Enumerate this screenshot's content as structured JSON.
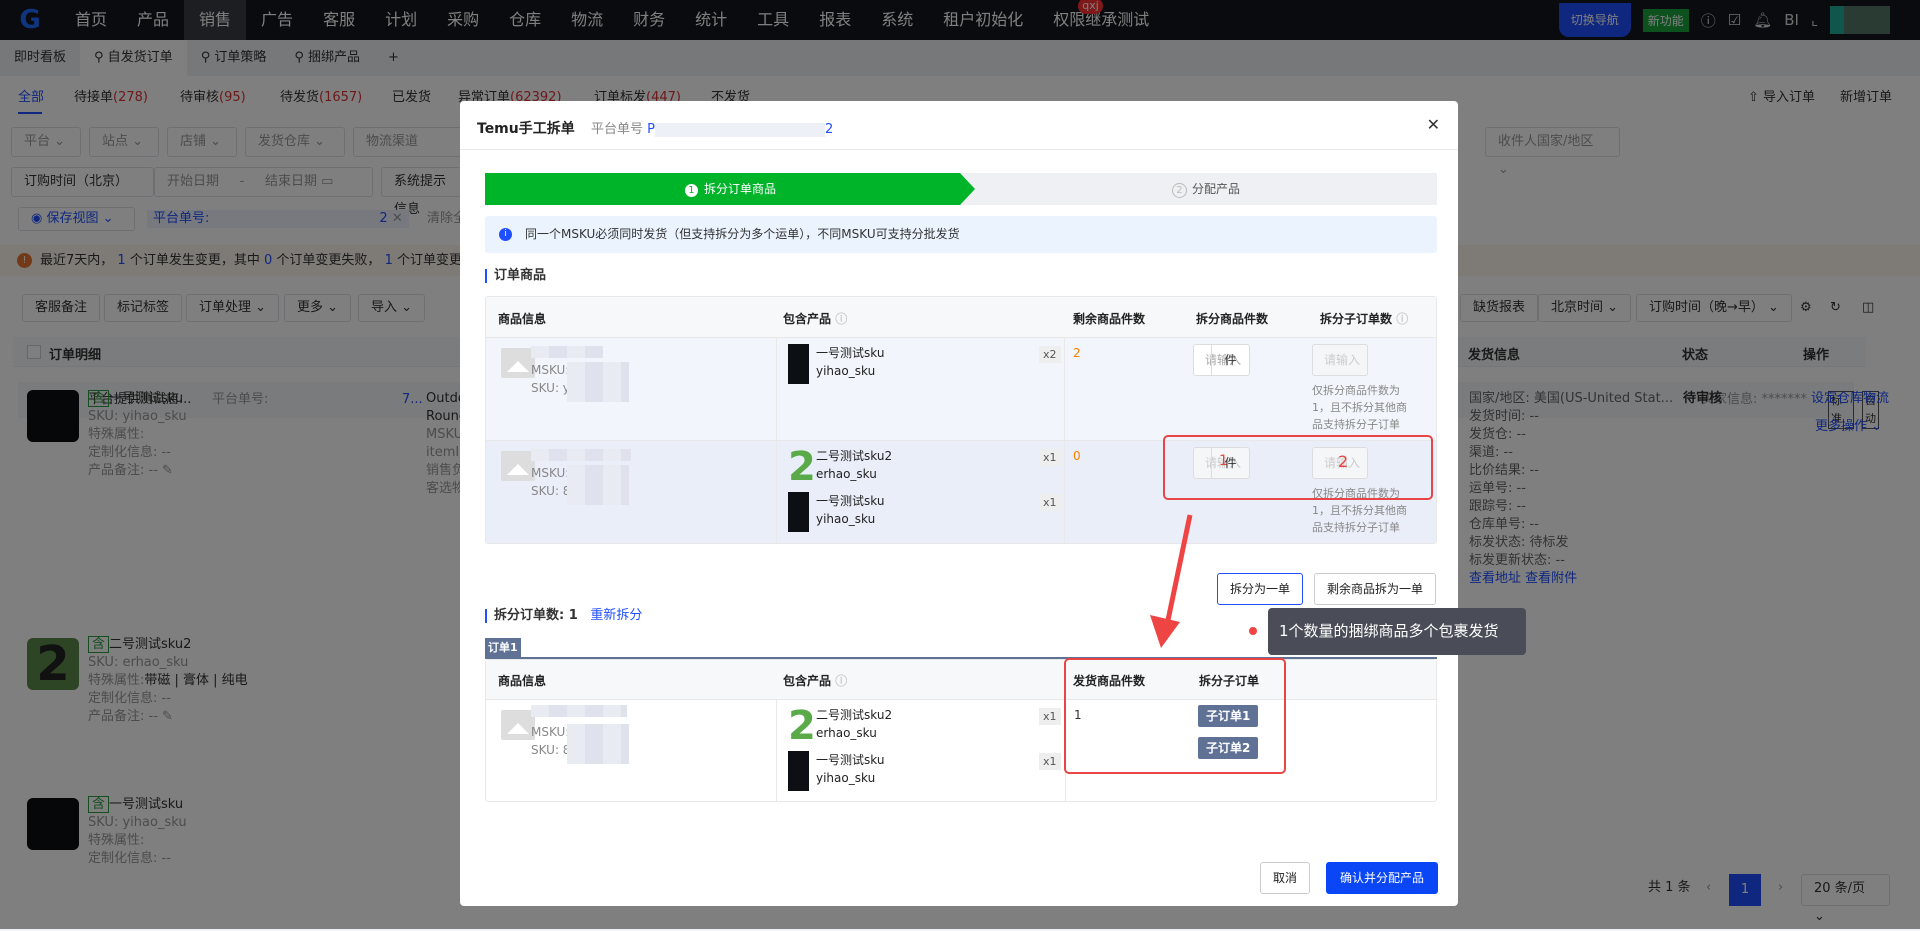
{
  "nav": {
    "logo": "G",
    "items": [
      "首页",
      "产品",
      "销售",
      "广告",
      "客服",
      "计划",
      "采购",
      "仓库",
      "物流",
      "财务",
      "统计",
      "工具",
      "报表",
      "系统",
      "租户初始化",
      "权限继承测试"
    ],
    "badge": "qxj",
    "switch_nav": "切换导航",
    "new_feature": "新功能",
    "bi": "BI"
  },
  "tabs": [
    "即时看板",
    "自发货订单",
    "订单策略",
    "捆绑产品",
    "+"
  ],
  "status_tabs": [
    {
      "label": "全部",
      "count": ""
    },
    {
      "label": "待接单",
      "count": "(278)"
    },
    {
      "label": "待审核",
      "count": "(95)"
    },
    {
      "label": "待发货",
      "count": "(1657)"
    },
    {
      "label": "已发货",
      "count": ""
    },
    {
      "label": "异常订单",
      "count": "(62392)"
    },
    {
      "label": "订单标发",
      "count": "(447)"
    },
    {
      "label": "不发货",
      "count": ""
    }
  ],
  "top_actions": {
    "import": "导入订单",
    "add": "新增订单"
  },
  "filters": {
    "platform": "平台",
    "site": "站点",
    "store": "店铺",
    "warehouse": "发货仓库",
    "channel": "物流渠道",
    "country": "收件人国家/地区",
    "time_type": "订购时间（北京）",
    "start": "开始日期",
    "end": "结束日期",
    "sys": "系统提示信息",
    "save_view": "保存视图",
    "chip_label": "平台单号:",
    "chip_tail": "2",
    "clear": "清除全"
  },
  "notice": {
    "a": "最近7天内，",
    "n1": "1",
    "b": "个订单发生变更，其中",
    "n2": "0",
    "c": "个订单变更失败，",
    "n3": "1",
    "d": "个订单变更成功"
  },
  "toolbar": {
    "remark": "客服备注",
    "tag": "标记标签",
    "process": "订单处理",
    "more": "更多",
    "import": "导入",
    "export": "导",
    "stock": "缺货报表",
    "tz": "北京时间",
    "sort": "订购时间（晚→早）"
  },
  "order_table": {
    "header": "订单明细",
    "ship_col": "发货信息",
    "status_col": "状态",
    "action_col": "操作",
    "store": "平台提供测试店...",
    "platform_no": "平台单号:",
    "no_tail": "7...",
    "buyer": "买家信息: *******",
    "tag_std": "标准",
    "tag_auto": "自动",
    "items": [
      {
        "tag": "含",
        "name": "一号测试sku",
        "sku": "SKU: yihao_sku",
        "attr": "特殊属性:",
        "attr_val": "",
        "custom": "定制化信息: --",
        "note": "产品备注: --"
      },
      {
        "tag": "含",
        "name": "二号测试sku2",
        "sku": "SKU: erhao_sku",
        "attr": "特殊属性:",
        "attr_val": "带磁 | 膏体 | 纯电",
        "custom": "定制化信息: --",
        "note": "产品备注: --"
      },
      {
        "tag": "含",
        "name": "一号测试sku",
        "sku": "SKU: yihao_sku",
        "attr": "特殊属性:",
        "attr_val": "",
        "custom": "定制化信息: --",
        "note": ""
      }
    ],
    "mid_col": [
      "Outdo",
      "Round",
      "MSKU",
      "itemI",
      "销售负",
      "客选物"
    ],
    "ship": [
      "国家/地区: 美国(US-United Stat...",
      "发货时间: --",
      "发货仓: --",
      "渠道: --",
      "比价结果: --",
      "运单号: --",
      "跟踪号: --",
      "仓库单号: --",
      "标发状态: 待标发",
      "标发更新状态: --"
    ],
    "view_addr": "查看地址",
    "view_att": "查看附件",
    "status": "待审核",
    "act1": "设定仓库物流",
    "act2": "更多操作"
  },
  "pagination": {
    "total": "共 1 条",
    "page": "1",
    "size": "20 条/页"
  },
  "modal": {
    "title": "Temu手工拆单",
    "sub": "平台单号",
    "no_head": "P",
    "no_tail": "2",
    "step1": "拆分订单商品",
    "step2": "分配产品",
    "info": "同一个MSKU必须同时发货（但支持拆分为多个运单），不同MSKU可支持分批发货",
    "sec1": "订单商品",
    "cols": [
      "商品信息",
      "包含产品",
      "剩余商品件数",
      "拆分商品件数",
      "拆分子订单数"
    ],
    "msku": "MSKU:",
    "sku1": "SKU: y",
    "sku2": "SKU: 8",
    "p1": {
      "name": "一号测试sku",
      "code": "yihao_sku",
      "qty": "x2",
      "remain": "2"
    },
    "p2a": {
      "name": "二号测试sku2",
      "code": "erhao_sku",
      "qty": "x1"
    },
    "p2b": {
      "name": "一号测试sku",
      "code": "yihao_sku",
      "qty": "x1",
      "remain": "0"
    },
    "placeholder": "请输入",
    "unit": "件",
    "hint": "仅拆分商品件数为1，且不拆分其他商品支持拆分子订单",
    "annot1": "1",
    "annot2": "2",
    "btn_split": "拆分为一单",
    "btn_rest": "剩余商品拆为一单",
    "split_count_label": "拆分订单数:",
    "split_count": "1",
    "resplit": "重新拆分",
    "order_tab": "订单1",
    "cols2": [
      "商品信息",
      "包含产品",
      "发货商品件数",
      "拆分子订单"
    ],
    "ship_qty": "1",
    "sub1": "子订单1",
    "sub2": "子订单2",
    "cancel": "取消",
    "confirm": "确认并分配产品"
  },
  "tooltip": "1个数量的捆绑商品多个包裹发货"
}
